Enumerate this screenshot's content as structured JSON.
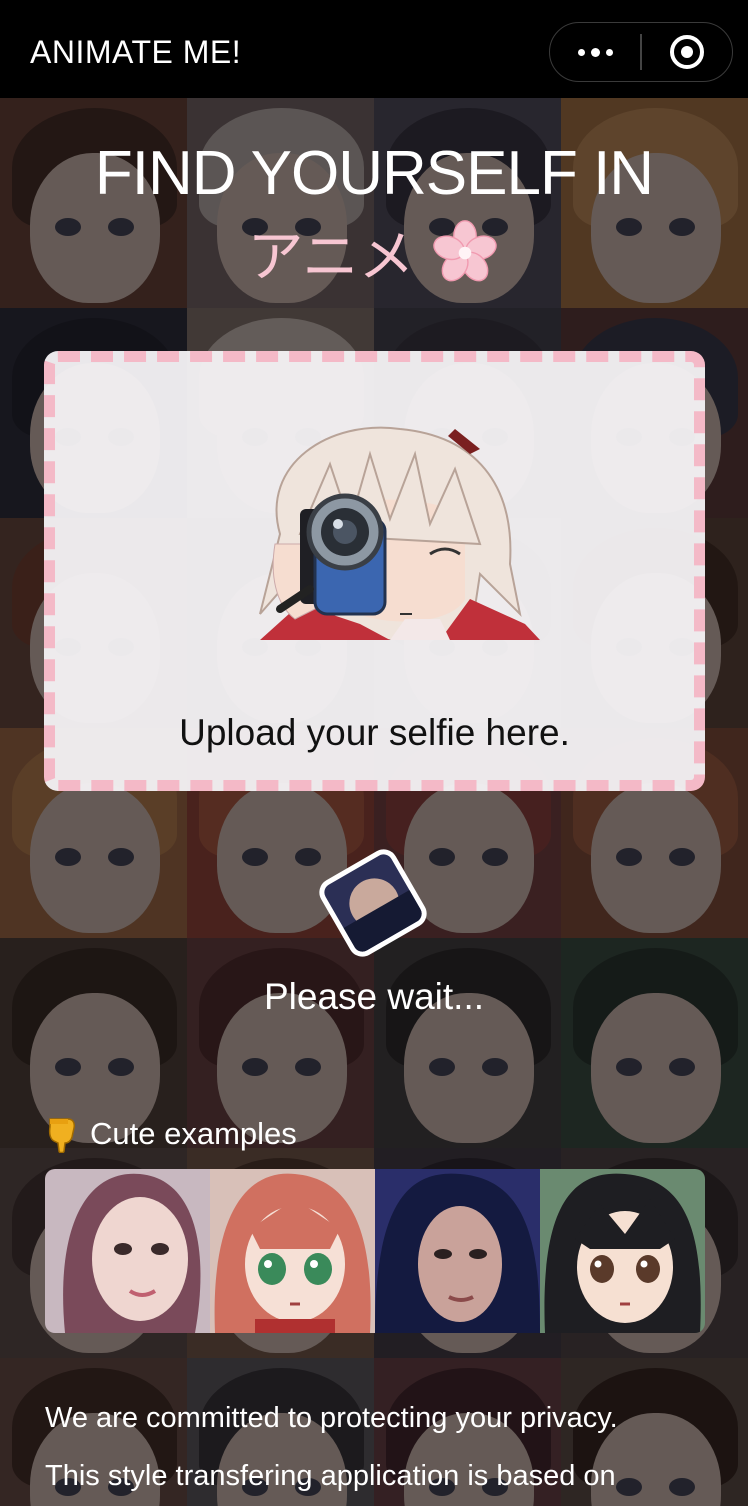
{
  "topbar": {
    "title": "ANIMATE ME!",
    "more_icon": "more-dots-icon",
    "close_icon": "target-close-icon"
  },
  "hero": {
    "headline": "FIND YOURSELF IN",
    "subhead": "アニメ",
    "subhead_icon": "sakura-flower-icon",
    "accent_color": "#f7c6d2"
  },
  "upload": {
    "text": "Upload your selfie here.",
    "border_color": "#f4b9c7"
  },
  "status": {
    "text": "Please wait..."
  },
  "examples": {
    "label": "Cute examples",
    "icon": "pointing-down-hand-icon",
    "items": [
      {
        "name": "example-selfie-1"
      },
      {
        "name": "example-anime-1"
      },
      {
        "name": "example-selfie-2"
      },
      {
        "name": "example-anime-2"
      }
    ]
  },
  "privacy": {
    "line1": "We are committed to protecting your privacy.",
    "line2": "This style transfering application is based on"
  }
}
